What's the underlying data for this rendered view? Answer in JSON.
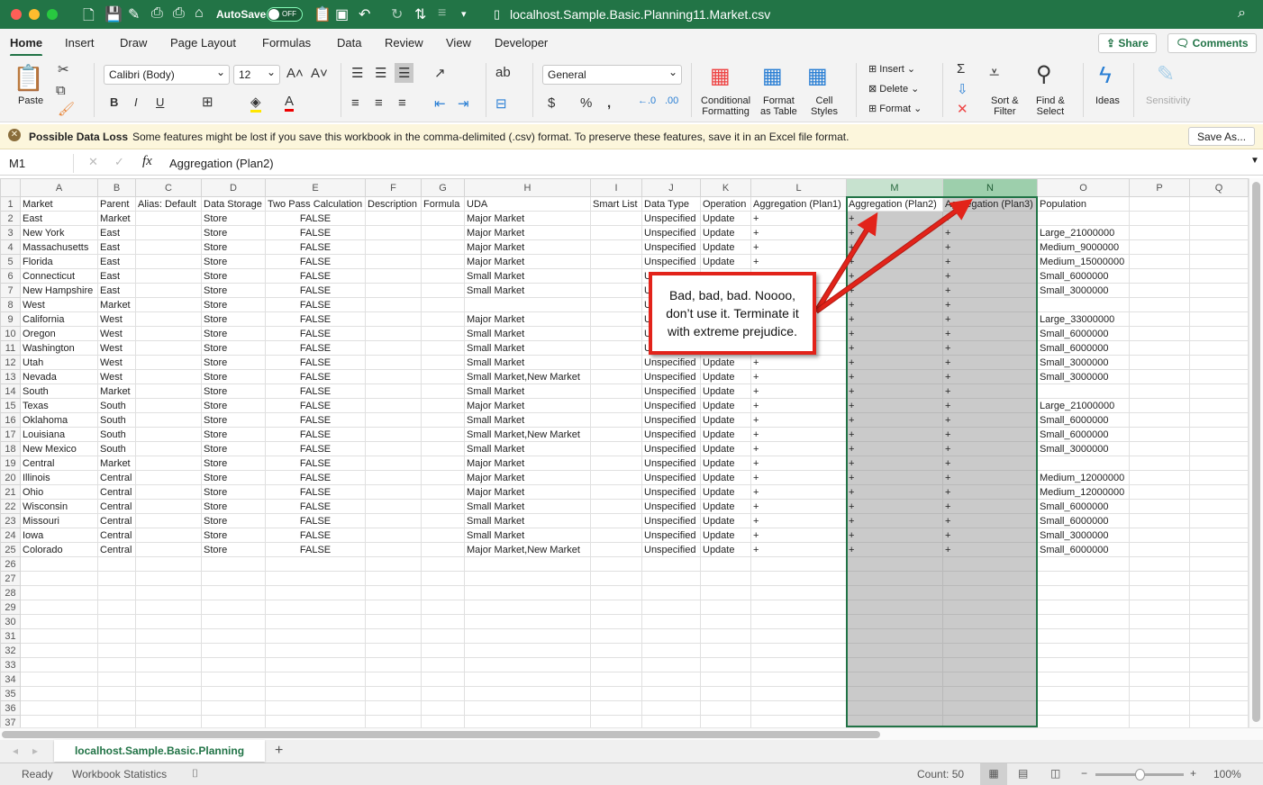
{
  "title_bar": {
    "autosave_label": "AutoSave",
    "autosave_state": "OFF",
    "document_title": "localhost.Sample.Basic.Planning11.Market.csv"
  },
  "menu_tabs": [
    "Home",
    "Insert",
    "Draw",
    "Page Layout",
    "Formulas",
    "Data",
    "Review",
    "View",
    "Developer"
  ],
  "active_tab": "Home",
  "top_buttons": {
    "share": "Share",
    "comments": "Comments"
  },
  "ribbon": {
    "paste": "Paste",
    "font_name": "Calibri (Body)",
    "font_size": "12",
    "number_format": "General",
    "conditional_formatting": [
      "Conditional",
      "Formatting"
    ],
    "format_as_table": [
      "Format",
      "as Table"
    ],
    "cell_styles": [
      "Cell",
      "Styles"
    ],
    "insert": "Insert",
    "delete": "Delete",
    "format": "Format",
    "sort_filter": [
      "Sort &",
      "Filter"
    ],
    "find_select": [
      "Find &",
      "Select"
    ],
    "ideas": "Ideas",
    "sensitivity": "Sensitivity",
    "bold": "B",
    "italic": "I",
    "underline": "U"
  },
  "info_bar": {
    "title": "Possible Data Loss",
    "message": "Some features might be lost if you save this workbook in the comma-delimited (.csv) format. To preserve these features, save it in an Excel file format.",
    "button": "Save As..."
  },
  "formula_bar": {
    "name_box": "M1",
    "fx": "fx",
    "formula": "Aggregation (Plan2)"
  },
  "columns": [
    "A",
    "B",
    "C",
    "D",
    "E",
    "F",
    "G",
    "H",
    "I",
    "J",
    "K",
    "L",
    "M",
    "N",
    "O",
    "P",
    "Q"
  ],
  "selected_columns": [
    "M",
    "N"
  ],
  "row_count": 37,
  "rows": [
    [
      "Market",
      "Parent",
      "Alias: Default",
      "Data Storage",
      "Two Pass Calculation",
      "Description",
      "Formula",
      "UDA",
      "Smart List",
      "Data Type",
      "Operation",
      "Aggregation (Plan1)",
      "Aggregation (Plan2)",
      "Aggregation (Plan3)",
      "Population"
    ],
    [
      "East",
      "Market",
      "",
      "Store",
      "FALSE",
      "",
      "",
      "Major Market",
      "",
      "Unspecified",
      "Update",
      "+",
      "+",
      "+",
      ""
    ],
    [
      "New York",
      "East",
      "",
      "Store",
      "FALSE",
      "",
      "",
      "Major Market",
      "",
      "Unspecified",
      "Update",
      "+",
      "+",
      "+",
      "Large_21000000"
    ],
    [
      "Massachusetts",
      "East",
      "",
      "Store",
      "FALSE",
      "",
      "",
      "Major Market",
      "",
      "Unspecified",
      "Update",
      "+",
      "+",
      "+",
      "Medium_9000000"
    ],
    [
      "Florida",
      "East",
      "",
      "Store",
      "FALSE",
      "",
      "",
      "Major Market",
      "",
      "Unspecified",
      "Update",
      "+",
      "+",
      "+",
      "Medium_15000000"
    ],
    [
      "Connecticut",
      "East",
      "",
      "Store",
      "FALSE",
      "",
      "",
      "Small Market",
      "",
      "Unspecified",
      "Update",
      "+",
      "+",
      "+",
      "Small_6000000"
    ],
    [
      "New Hampshire",
      "East",
      "",
      "Store",
      "FALSE",
      "",
      "",
      "Small Market",
      "",
      "Unspecified",
      "Update",
      "+",
      "+",
      "+",
      "Small_3000000"
    ],
    [
      "West",
      "Market",
      "",
      "Store",
      "FALSE",
      "",
      "",
      "",
      "",
      "Unspecified",
      "Update",
      "+",
      "+",
      "+",
      ""
    ],
    [
      "California",
      "West",
      "",
      "Store",
      "FALSE",
      "",
      "",
      "Major Market",
      "",
      "Unspecified",
      "Update",
      "+",
      "+",
      "+",
      "Large_33000000"
    ],
    [
      "Oregon",
      "West",
      "",
      "Store",
      "FALSE",
      "",
      "",
      "Small Market",
      "",
      "Unspecified",
      "Update",
      "+",
      "+",
      "+",
      "Small_6000000"
    ],
    [
      "Washington",
      "West",
      "",
      "Store",
      "FALSE",
      "",
      "",
      "Small Market",
      "",
      "Unspecified",
      "Update",
      "+",
      "+",
      "+",
      "Small_6000000"
    ],
    [
      "Utah",
      "West",
      "",
      "Store",
      "FALSE",
      "",
      "",
      "Small Market",
      "",
      "Unspecified",
      "Update",
      "+",
      "+",
      "+",
      "Small_3000000"
    ],
    [
      "Nevada",
      "West",
      "",
      "Store",
      "FALSE",
      "",
      "",
      "Small Market,New Market",
      "",
      "Unspecified",
      "Update",
      "+",
      "+",
      "+",
      "Small_3000000"
    ],
    [
      "South",
      "Market",
      "",
      "Store",
      "FALSE",
      "",
      "",
      "Small Market",
      "",
      "Unspecified",
      "Update",
      "+",
      "+",
      "+",
      ""
    ],
    [
      "Texas",
      "South",
      "",
      "Store",
      "FALSE",
      "",
      "",
      "Major Market",
      "",
      "Unspecified",
      "Update",
      "+",
      "+",
      "+",
      "Large_21000000"
    ],
    [
      "Oklahoma",
      "South",
      "",
      "Store",
      "FALSE",
      "",
      "",
      "Small Market",
      "",
      "Unspecified",
      "Update",
      "+",
      "+",
      "+",
      "Small_6000000"
    ],
    [
      "Louisiana",
      "South",
      "",
      "Store",
      "FALSE",
      "",
      "",
      "Small Market,New Market",
      "",
      "Unspecified",
      "Update",
      "+",
      "+",
      "+",
      "Small_6000000"
    ],
    [
      "New Mexico",
      "South",
      "",
      "Store",
      "FALSE",
      "",
      "",
      "Small Market",
      "",
      "Unspecified",
      "Update",
      "+",
      "+",
      "+",
      "Small_3000000"
    ],
    [
      "Central",
      "Market",
      "",
      "Store",
      "FALSE",
      "",
      "",
      "Major Market",
      "",
      "Unspecified",
      "Update",
      "+",
      "+",
      "+",
      ""
    ],
    [
      "Illinois",
      "Central",
      "",
      "Store",
      "FALSE",
      "",
      "",
      "Major Market",
      "",
      "Unspecified",
      "Update",
      "+",
      "+",
      "+",
      "Medium_12000000"
    ],
    [
      "Ohio",
      "Central",
      "",
      "Store",
      "FALSE",
      "",
      "",
      "Major Market",
      "",
      "Unspecified",
      "Update",
      "+",
      "+",
      "+",
      "Medium_12000000"
    ],
    [
      "Wisconsin",
      "Central",
      "",
      "Store",
      "FALSE",
      "",
      "",
      "Small Market",
      "",
      "Unspecified",
      "Update",
      "+",
      "+",
      "+",
      "Small_6000000"
    ],
    [
      "Missouri",
      "Central",
      "",
      "Store",
      "FALSE",
      "",
      "",
      "Small Market",
      "",
      "Unspecified",
      "Update",
      "+",
      "+",
      "+",
      "Small_6000000"
    ],
    [
      "Iowa",
      "Central",
      "",
      "Store",
      "FALSE",
      "",
      "",
      "Small Market",
      "",
      "Unspecified",
      "Update",
      "+",
      "+",
      "+",
      "Small_3000000"
    ],
    [
      "Colorado",
      "Central",
      "",
      "Store",
      "FALSE",
      "",
      "",
      "Major Market,New Market",
      "",
      "Unspecified",
      "Update",
      "+",
      "+",
      "+",
      "Small_6000000"
    ]
  ],
  "callout": {
    "text": "Bad, bad, bad.  Noooo, don’t use it.  Terminate it with extreme prejudice.",
    "color": "#e2231a"
  },
  "sheet_tab": "localhost.Sample.Basic.Planning",
  "status_bar": {
    "ready": "Ready",
    "workbook_statistics": "Workbook Statistics",
    "count": "Count: 50",
    "zoom": "100%",
    "zoom_level_percent": 100
  },
  "colors": {
    "accent": "#217346",
    "selection_fill": "#cacaca"
  }
}
